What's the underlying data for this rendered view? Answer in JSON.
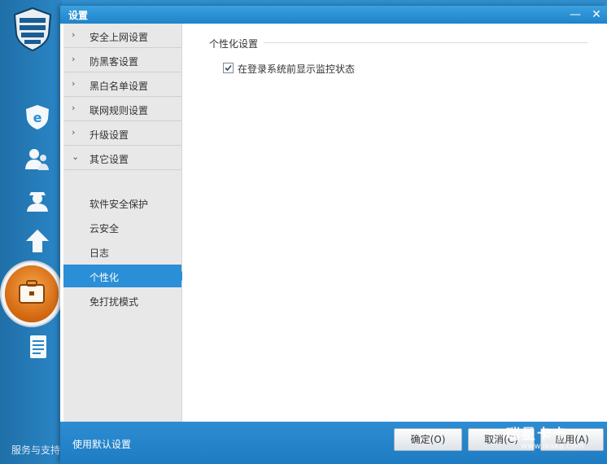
{
  "app": {
    "bottom_text": "服务与支持"
  },
  "dialog": {
    "title": "设置",
    "minimize_glyph": "—",
    "close_glyph": "✕"
  },
  "nav": {
    "categories": [
      {
        "label": "安全上网设置",
        "expanded": false
      },
      {
        "label": "防黑客设置",
        "expanded": false
      },
      {
        "label": "黑白名单设置",
        "expanded": false
      },
      {
        "label": "联网规则设置",
        "expanded": false
      },
      {
        "label": "升级设置",
        "expanded": false
      },
      {
        "label": "其它设置",
        "expanded": true
      }
    ],
    "sub_items": [
      {
        "label": "软件安全保护",
        "active": false
      },
      {
        "label": "云安全",
        "active": false
      },
      {
        "label": "日志",
        "active": false
      },
      {
        "label": "个性化",
        "active": true
      },
      {
        "label": "免打扰模式",
        "active": false
      }
    ]
  },
  "content": {
    "section_title": "个性化设置",
    "option": {
      "label": "在登录系统前显示监控状态",
      "checked": true
    }
  },
  "footer": {
    "restore_label": "使用默认设置",
    "ok_label": "确定(O)",
    "cancel_label": "取消(C)",
    "apply_label": "应用(A)"
  },
  "watermark": {
    "big": "瑞星卡卡",
    "url": "www.ikaka.com"
  },
  "colors": {
    "title_bar": "#1f83c9",
    "nav_active": "#2a8fd6",
    "nav_bg": "#e8e8e8",
    "footer": "#2d8cd2"
  },
  "icons": {
    "app_logo": "shield-wall-icon",
    "sidebar": [
      "ie-shield-icon",
      "users-icon",
      "hacker-icon",
      "upload-arrow-icon",
      "toolbox-icon",
      "document-icon"
    ]
  }
}
